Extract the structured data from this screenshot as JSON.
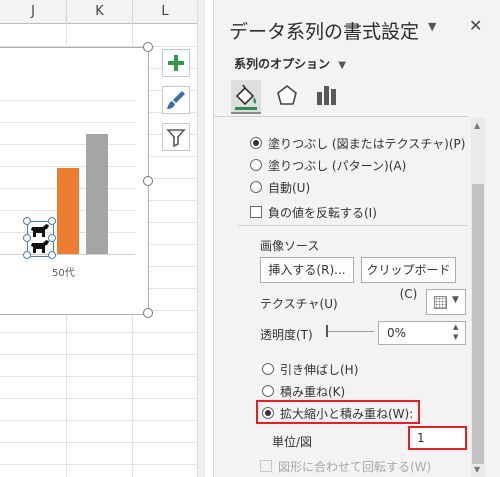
{
  "sheet": {
    "columns": [
      "J",
      "K",
      "L"
    ],
    "chart": {
      "category_label": "50代",
      "colors": {
        "orange": "#ed7d31",
        "gray": "#a5a5a5",
        "selection": "#4a7fc1"
      }
    },
    "side_buttons": [
      {
        "icon": "plus-icon",
        "color": "#2e9c4e"
      },
      {
        "icon": "brush-icon",
        "color": "#3a6ea5"
      },
      {
        "icon": "filter-icon",
        "color": "#595959"
      }
    ]
  },
  "pane": {
    "title": "データ系列の書式設定",
    "title_arrow": "▼",
    "close": "✕",
    "series_options": "系列のオプション",
    "series_options_arrow": "▼",
    "tabs": [
      "fill-line-icon",
      "effects-icon",
      "series-options-icon"
    ],
    "fill_options": [
      {
        "label": "塗りつぶし (図またはテクスチャ)(P)",
        "selected": true
      },
      {
        "label": "塗りつぶし (パターン)(A)",
        "selected": false
      },
      {
        "label": "自動(U)",
        "selected": false
      }
    ],
    "invert_if_negative": "負の値を反転する(I)",
    "image_source": "画像ソース",
    "insert_button": "挿入する(R)...",
    "clipboard_button": "クリップボード(C)",
    "texture_label": "テクスチャ(U)",
    "transparency_label": "透明度(T)",
    "transparency_value": "0%",
    "stack_options": [
      {
        "label": "引き伸ばし(H)",
        "selected": false
      },
      {
        "label": "積み重ね(K)",
        "selected": false
      },
      {
        "label": "拡大縮小と積み重ね(W):",
        "selected": true
      }
    ],
    "units_label": "単位/図",
    "units_value": "1",
    "rotate_label": "図形に合わせて回転する(W)",
    "highlight_color": "#e51f23"
  }
}
